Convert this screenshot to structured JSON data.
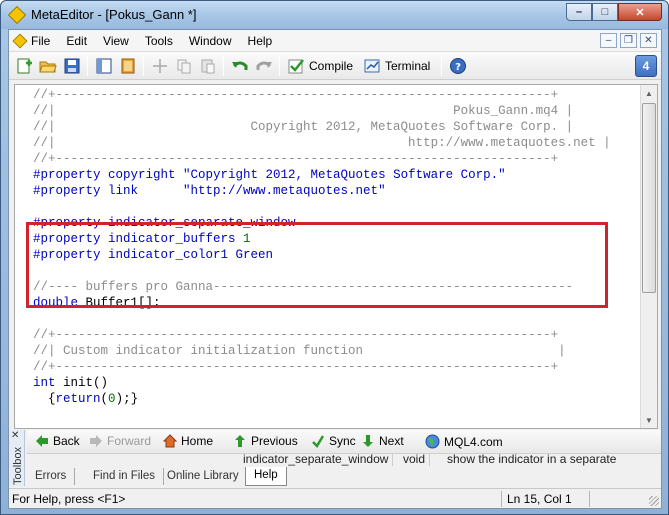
{
  "window": {
    "title": "MetaEditor - [Pokus_Gann *]",
    "buttons": {
      "minimize": "–",
      "maximize": "□",
      "close": "✕"
    }
  },
  "menu": {
    "items": [
      "File",
      "Edit",
      "View",
      "Tools",
      "Window",
      "Help"
    ],
    "mdi": {
      "minimize": "–",
      "restore": "❐",
      "close": "✕"
    }
  },
  "toolbar": {
    "compile_label": "Compile",
    "terminal_label": "Terminal",
    "corner_badge": "4"
  },
  "editor": {
    "lines": [
      [
        [
          "c-comment",
          "//+------------------------------------------------------------------+"
        ]
      ],
      [
        [
          "c-comment",
          "//|                                                     Pokus_Gann.mq4 |"
        ]
      ],
      [
        [
          "c-comment",
          "//|                          Copyright 2012, MetaQuotes Software Corp. |"
        ]
      ],
      [
        [
          "c-comment",
          "//|                                               http://www.metaquotes.net |"
        ]
      ],
      [
        [
          "c-comment",
          "//+------------------------------------------------------------------+"
        ]
      ],
      [
        [
          "c-kw",
          "#property copyright "
        ],
        [
          "c-str",
          "\"Copyright 2012, MetaQuotes Software Corp.\""
        ]
      ],
      [
        [
          "c-kw",
          "#property link      "
        ],
        [
          "c-str",
          "\"http://www.metaquotes.net\""
        ]
      ],
      [
        [
          "c-plain",
          ""
        ]
      ],
      [
        [
          "c-kw",
          "#property indicator_separate_window"
        ]
      ],
      [
        [
          "c-kw",
          "#property indicator_buffers "
        ],
        [
          "c-num",
          "1"
        ]
      ],
      [
        [
          "c-kw",
          "#property indicator_color1 "
        ],
        [
          "c-kw",
          "Green"
        ]
      ],
      [
        [
          "c-plain",
          ""
        ]
      ],
      [
        [
          "c-comment",
          "//---- buffers pro Ganna------------------------------------------------"
        ]
      ],
      [
        [
          "c-kw",
          "double "
        ],
        [
          "c-plain",
          "Buffer1[];"
        ]
      ],
      [
        [
          "c-plain",
          ""
        ]
      ],
      [
        [
          "c-comment",
          "//+------------------------------------------------------------------+"
        ]
      ],
      [
        [
          "c-comment",
          "//| Custom indicator initialization function                          |"
        ]
      ],
      [
        [
          "c-comment",
          "//+------------------------------------------------------------------+"
        ]
      ],
      [
        [
          "c-kw",
          "int "
        ],
        [
          "c-plain",
          "init()"
        ]
      ],
      [
        [
          "c-plain",
          "  {"
        ],
        [
          "c-kw",
          "return"
        ],
        [
          "c-plain",
          "("
        ],
        [
          "c-num",
          "0"
        ],
        [
          "c-plain",
          ");}"
        ]
      ]
    ]
  },
  "toolbox": {
    "label": "Toolbox",
    "nav": {
      "back": "Back",
      "forward": "Forward",
      "home": "Home",
      "previous": "Previous",
      "sync": "Sync",
      "next": "Next",
      "mql4": "MQL4.com"
    },
    "help_row": {
      "name": "indicator_separate_window",
      "type": "void",
      "desc": "show the indicator in a separate"
    },
    "tabs": [
      "Errors",
      "Find in Files",
      "Online Library",
      "Help"
    ],
    "active_tab": "Help"
  },
  "status": {
    "left": "For Help, press <F1>",
    "position": "Ln 15, Col 1"
  },
  "colors": {
    "highlight_box": "#d2232a",
    "keyword": "#0000c8",
    "comment": "#8c8c8c",
    "number": "#007000"
  }
}
